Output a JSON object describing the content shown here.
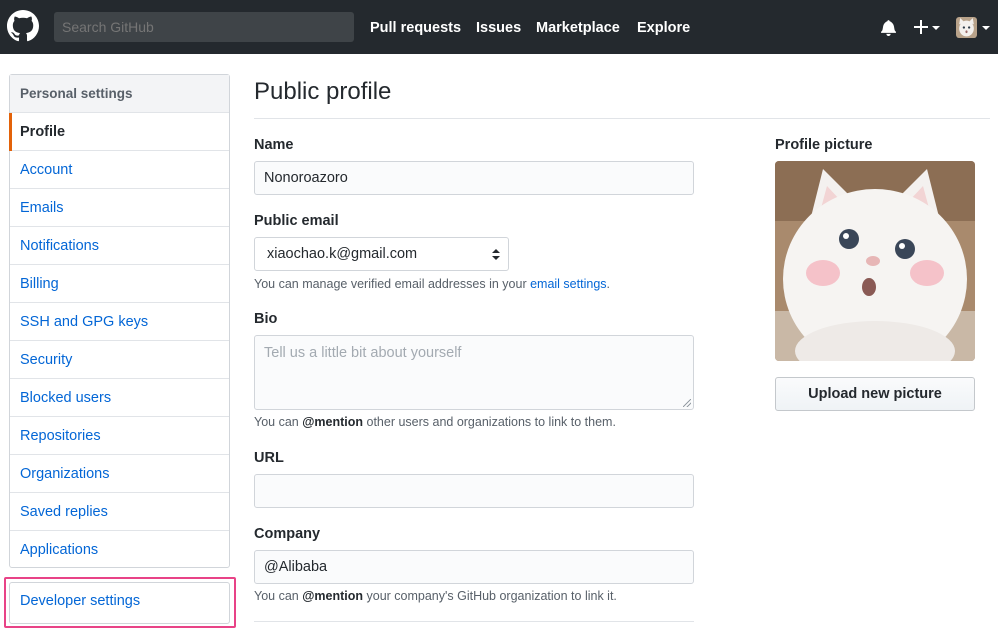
{
  "header": {
    "search_placeholder": "Search GitHub",
    "nav": [
      "Pull requests",
      "Issues",
      "Marketplace",
      "Explore"
    ],
    "icons": {
      "logo": "github-octocat-icon",
      "notifications": "bell-icon",
      "create": "plus-icon",
      "avatar": "user-avatar"
    }
  },
  "sidebar": {
    "heading": "Personal settings",
    "items": [
      {
        "label": "Profile",
        "selected": true
      },
      {
        "label": "Account"
      },
      {
        "label": "Emails"
      },
      {
        "label": "Notifications"
      },
      {
        "label": "Billing"
      },
      {
        "label": "SSH and GPG keys"
      },
      {
        "label": "Security"
      },
      {
        "label": "Blocked users"
      },
      {
        "label": "Repositories"
      },
      {
        "label": "Organizations"
      },
      {
        "label": "Saved replies"
      },
      {
        "label": "Applications"
      }
    ],
    "developer_settings": "Developer settings",
    "highlight_color": "#e84387"
  },
  "main": {
    "title": "Public profile",
    "name": {
      "label": "Name",
      "value": "Nonoroazoro"
    },
    "public_email": {
      "label": "Public email",
      "value": "xiaochao.k@gmail.com"
    },
    "email_note": {
      "before": "You can manage verified email addresses in your ",
      "link": "email settings",
      "after": "."
    },
    "bio": {
      "label": "Bio",
      "placeholder": "Tell us a little bit about yourself"
    },
    "bio_note": {
      "before": "You can ",
      "mention": "@mention",
      "after": " other users and organizations to link to them."
    },
    "url": {
      "label": "URL",
      "value": ""
    },
    "company": {
      "label": "Company",
      "value": "@Alibaba"
    },
    "company_note": {
      "before": "You can ",
      "mention": "@mention",
      "after": " your company's GitHub organization to link it."
    }
  },
  "profile_picture": {
    "label": "Profile picture",
    "upload_button": "Upload new picture"
  },
  "colors": {
    "header_bg": "#24292e",
    "link": "#0366d6",
    "selected_marker": "#e36209"
  }
}
